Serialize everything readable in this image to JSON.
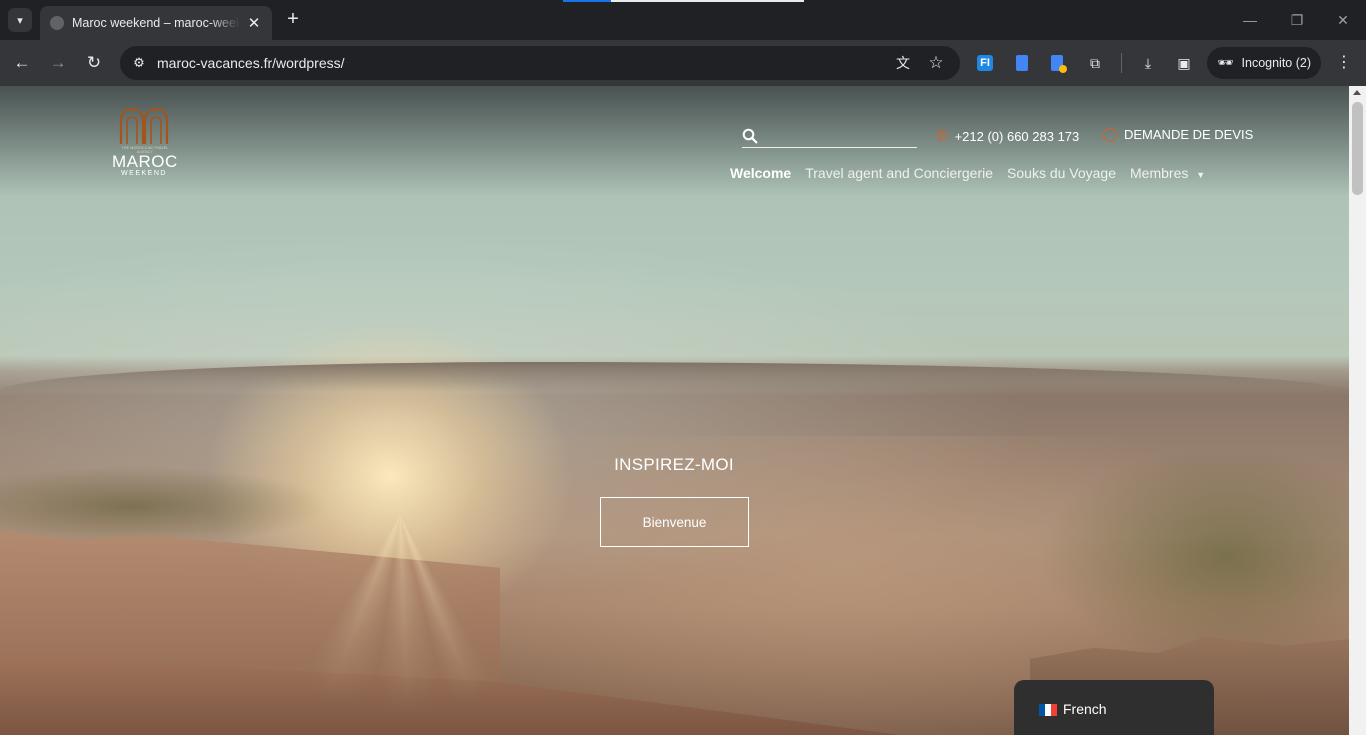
{
  "browser": {
    "tab_title": "Maroc weekend – maroc-weekend",
    "url": "maroc-vacances.fr/wordpress/",
    "incognito_label": "Incognito (2)",
    "icons": [
      "tab-search-icon",
      "close-icon",
      "plus-icon",
      "minimize-icon",
      "restore-icon",
      "window-close-icon",
      "back-arrow-icon",
      "forward-arrow-icon",
      "reload-icon",
      "site-info-icon",
      "translate-icon",
      "star-icon",
      "extension-fi-icon",
      "extension-doc-icon",
      "extension-doc-badge-icon",
      "puzzle-icon",
      "download-icon",
      "side-panel-icon",
      "incognito-icon",
      "kebab-menu-icon"
    ]
  },
  "site": {
    "logo": {
      "name": "MAROC",
      "sub": "WEEKEND",
      "tagline": "THE MOROCCAN TRAVEL AGENCY"
    },
    "search": {
      "placeholder": "",
      "value": ""
    },
    "phone": "+212 (0) 660 283 173",
    "devis": "DEMANDE DE DEVIS",
    "nav": [
      {
        "label": "Welcome",
        "active": true
      },
      {
        "label": "Travel agent and Conciergerie",
        "active": false
      },
      {
        "label": "Souks du Voyage",
        "active": false
      },
      {
        "label": "Membres",
        "active": false,
        "dropdown": true
      }
    ],
    "hero": {
      "title": "INSPIREZ-MOI",
      "button": "Bienvenue"
    },
    "language": {
      "label": "French"
    },
    "colors": {
      "accent": "#d2622c",
      "logo_arch": "#a4541b",
      "lang_bg": "#2f2f30"
    }
  }
}
